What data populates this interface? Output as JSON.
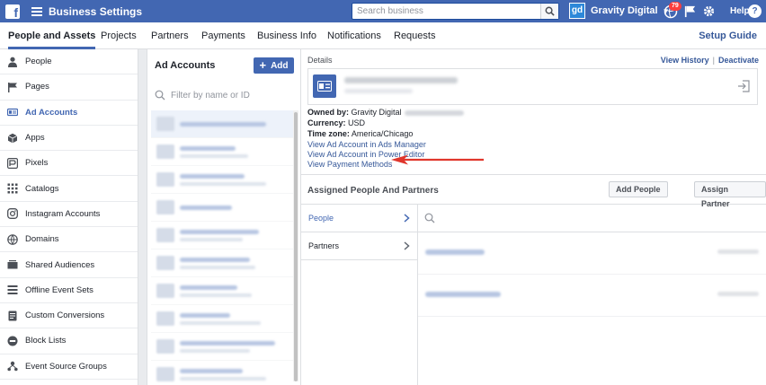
{
  "topbar": {
    "app_title": "Business Settings",
    "search_placeholder": "Search business",
    "account_name": "Gravity Digital",
    "account_initials": "gd",
    "notification_count": "79",
    "help_label": "Help"
  },
  "nav": {
    "tabs": [
      {
        "label": "People and Assets"
      },
      {
        "label": "Projects"
      },
      {
        "label": "Partners"
      },
      {
        "label": "Payments"
      },
      {
        "label": "Business Info"
      },
      {
        "label": "Notifications"
      },
      {
        "label": "Requests"
      }
    ],
    "setup_guide": "Setup Guide"
  },
  "sidebar": {
    "items": [
      {
        "label": "People",
        "icon": "person-icon"
      },
      {
        "label": "Pages",
        "icon": "flag-icon"
      },
      {
        "label": "Ad Accounts",
        "icon": "ad-account-icon"
      },
      {
        "label": "Apps",
        "icon": "cube-icon"
      },
      {
        "label": "Pixels",
        "icon": "pixel-icon"
      },
      {
        "label": "Catalogs",
        "icon": "grid-icon"
      },
      {
        "label": "Instagram Accounts",
        "icon": "instagram-icon"
      },
      {
        "label": "Domains",
        "icon": "globe-icon"
      },
      {
        "label": "Shared Audiences",
        "icon": "audience-icon"
      },
      {
        "label": "Offline Event Sets",
        "icon": "list-icon"
      },
      {
        "label": "Custom Conversions",
        "icon": "conversion-icon"
      },
      {
        "label": "Block Lists",
        "icon": "block-icon"
      },
      {
        "label": "Event Source Groups",
        "icon": "event-source-icon"
      }
    ],
    "active_index": 2
  },
  "ad_accounts": {
    "title": "Ad Accounts",
    "add_label": "Add",
    "filter_placeholder": "Filter by name or ID"
  },
  "details": {
    "label": "Details",
    "view_history": "View History",
    "deactivate": "Deactivate",
    "owned_by_label": "Owned by:",
    "owned_by_value": "Gravity Digital",
    "currency_label": "Currency:",
    "currency_value": "USD",
    "timezone_label": "Time zone:",
    "timezone_value": "America/Chicago",
    "link_ads_manager": "View Ad Account in Ads Manager",
    "link_power_editor": "View Ad Account in Power Editor",
    "link_payment_methods": "View Payment Methods"
  },
  "assigned": {
    "title": "Assigned People And Partners",
    "add_people": "Add People",
    "assign_partner": "Assign Partner",
    "subnav": [
      {
        "label": "People"
      },
      {
        "label": "Partners"
      }
    ]
  },
  "colors": {
    "brand": "#4267b2",
    "link": "#365899",
    "annotation_arrow": "#e0362c"
  }
}
